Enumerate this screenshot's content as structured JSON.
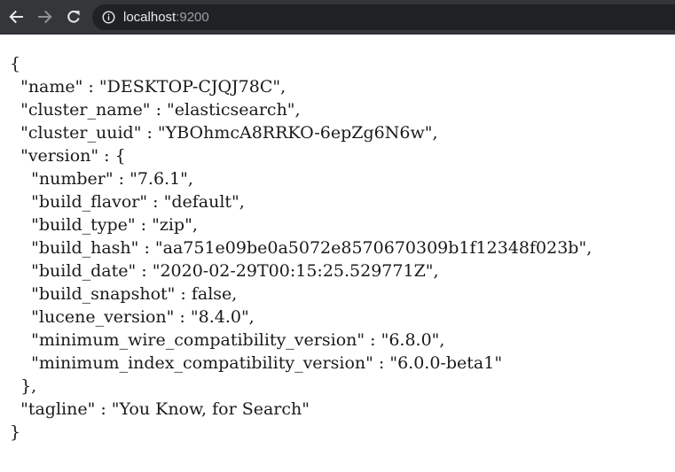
{
  "browser": {
    "url_host": "localhost",
    "url_port": ":9200"
  },
  "json_lines": [
    "{",
    "  \"name\" : \"DESKTOP-CJQJ78C\",",
    "  \"cluster_name\" : \"elasticsearch\",",
    "  \"cluster_uuid\" : \"YBOhmcA8RRKO-6epZg6N6w\",",
    "  \"version\" : {",
    "    \"number\" : \"7.6.1\",",
    "    \"build_flavor\" : \"default\",",
    "    \"build_type\" : \"zip\",",
    "    \"build_hash\" : \"aa751e09be0a5072e8570670309b1f12348f023b\",",
    "    \"build_date\" : \"2020-02-29T00:15:25.529771Z\",",
    "    \"build_snapshot\" : false,",
    "    \"lucene_version\" : \"8.4.0\",",
    "    \"minimum_wire_compatibility_version\" : \"6.8.0\",",
    "    \"minimum_index_compatibility_version\" : \"6.0.0-beta1\"",
    "  },",
    "  \"tagline\" : \"You Know, for Search\"",
    "}"
  ]
}
